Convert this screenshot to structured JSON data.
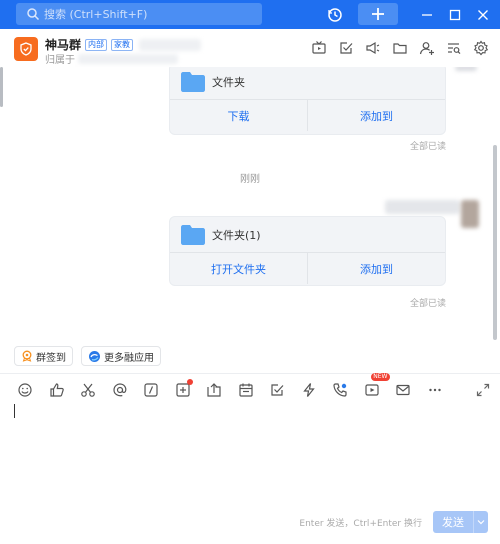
{
  "topbar": {
    "search_placeholder": "搜索 (Ctrl+Shift+F)",
    "plus_label": "+",
    "min_label": "—",
    "max_label": "☐",
    "close_label": "✕"
  },
  "header": {
    "group_name": "神马群",
    "tag_internal": "内部",
    "tag_school": "家教",
    "sub_prefix": "归属于"
  },
  "messages": [
    {
      "file_name": "文件夹",
      "action_left": "下载",
      "action_right": "添加到",
      "status": "全部已读"
    },
    {
      "file_name": "文件夹(1)",
      "action_left": "打开文件夹",
      "action_right": "添加到",
      "status": "全部已读"
    }
  ],
  "time_separator": "刚刚",
  "quick_apps": {
    "sign_in": "群签到",
    "more_apps": "更多融应用"
  },
  "composer": {
    "new_badge": "NEW",
    "send_hint": "Enter 发送，Ctrl+Enter 换行",
    "send_label": "发送"
  },
  "colors": {
    "brand": "#1f6ff0",
    "avatar": "#f76c1f",
    "folder": "#5aa7f3"
  }
}
